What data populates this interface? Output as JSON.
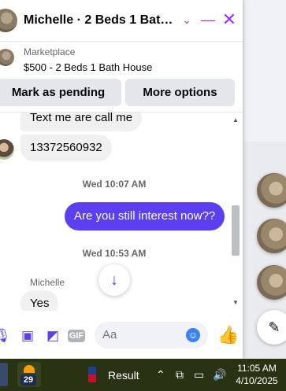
{
  "header": {
    "title": "Michelle · 2 Beds 1 Bath House",
    "chevron_icon": "chevron-down-icon",
    "minimize_icon": "minimize-icon",
    "close_icon": "close-icon"
  },
  "listing": {
    "label": "Marketplace",
    "price_title": "$500 - 2 Beds 1 Bath House"
  },
  "actions": {
    "pending": "Mark as pending",
    "more": "More options"
  },
  "messages": {
    "in1": "Text me are call me",
    "in2": "13372560932",
    "ts1": "Wed 10:07 AM",
    "out1": "Are you still interest now??",
    "ts2": "Wed 10:53 AM",
    "sender": "Michelle",
    "in3": "Yes"
  },
  "composer": {
    "placeholder": "Aa",
    "gif_label": "GIF"
  },
  "taskbar": {
    "weather_badge": "29",
    "result": "Result",
    "time": "11:05 AM",
    "date": "4/10/2025"
  },
  "colors": {
    "accent": "#5b3ff0",
    "header_icons": "#a033ff",
    "like": "#3b82f6"
  }
}
